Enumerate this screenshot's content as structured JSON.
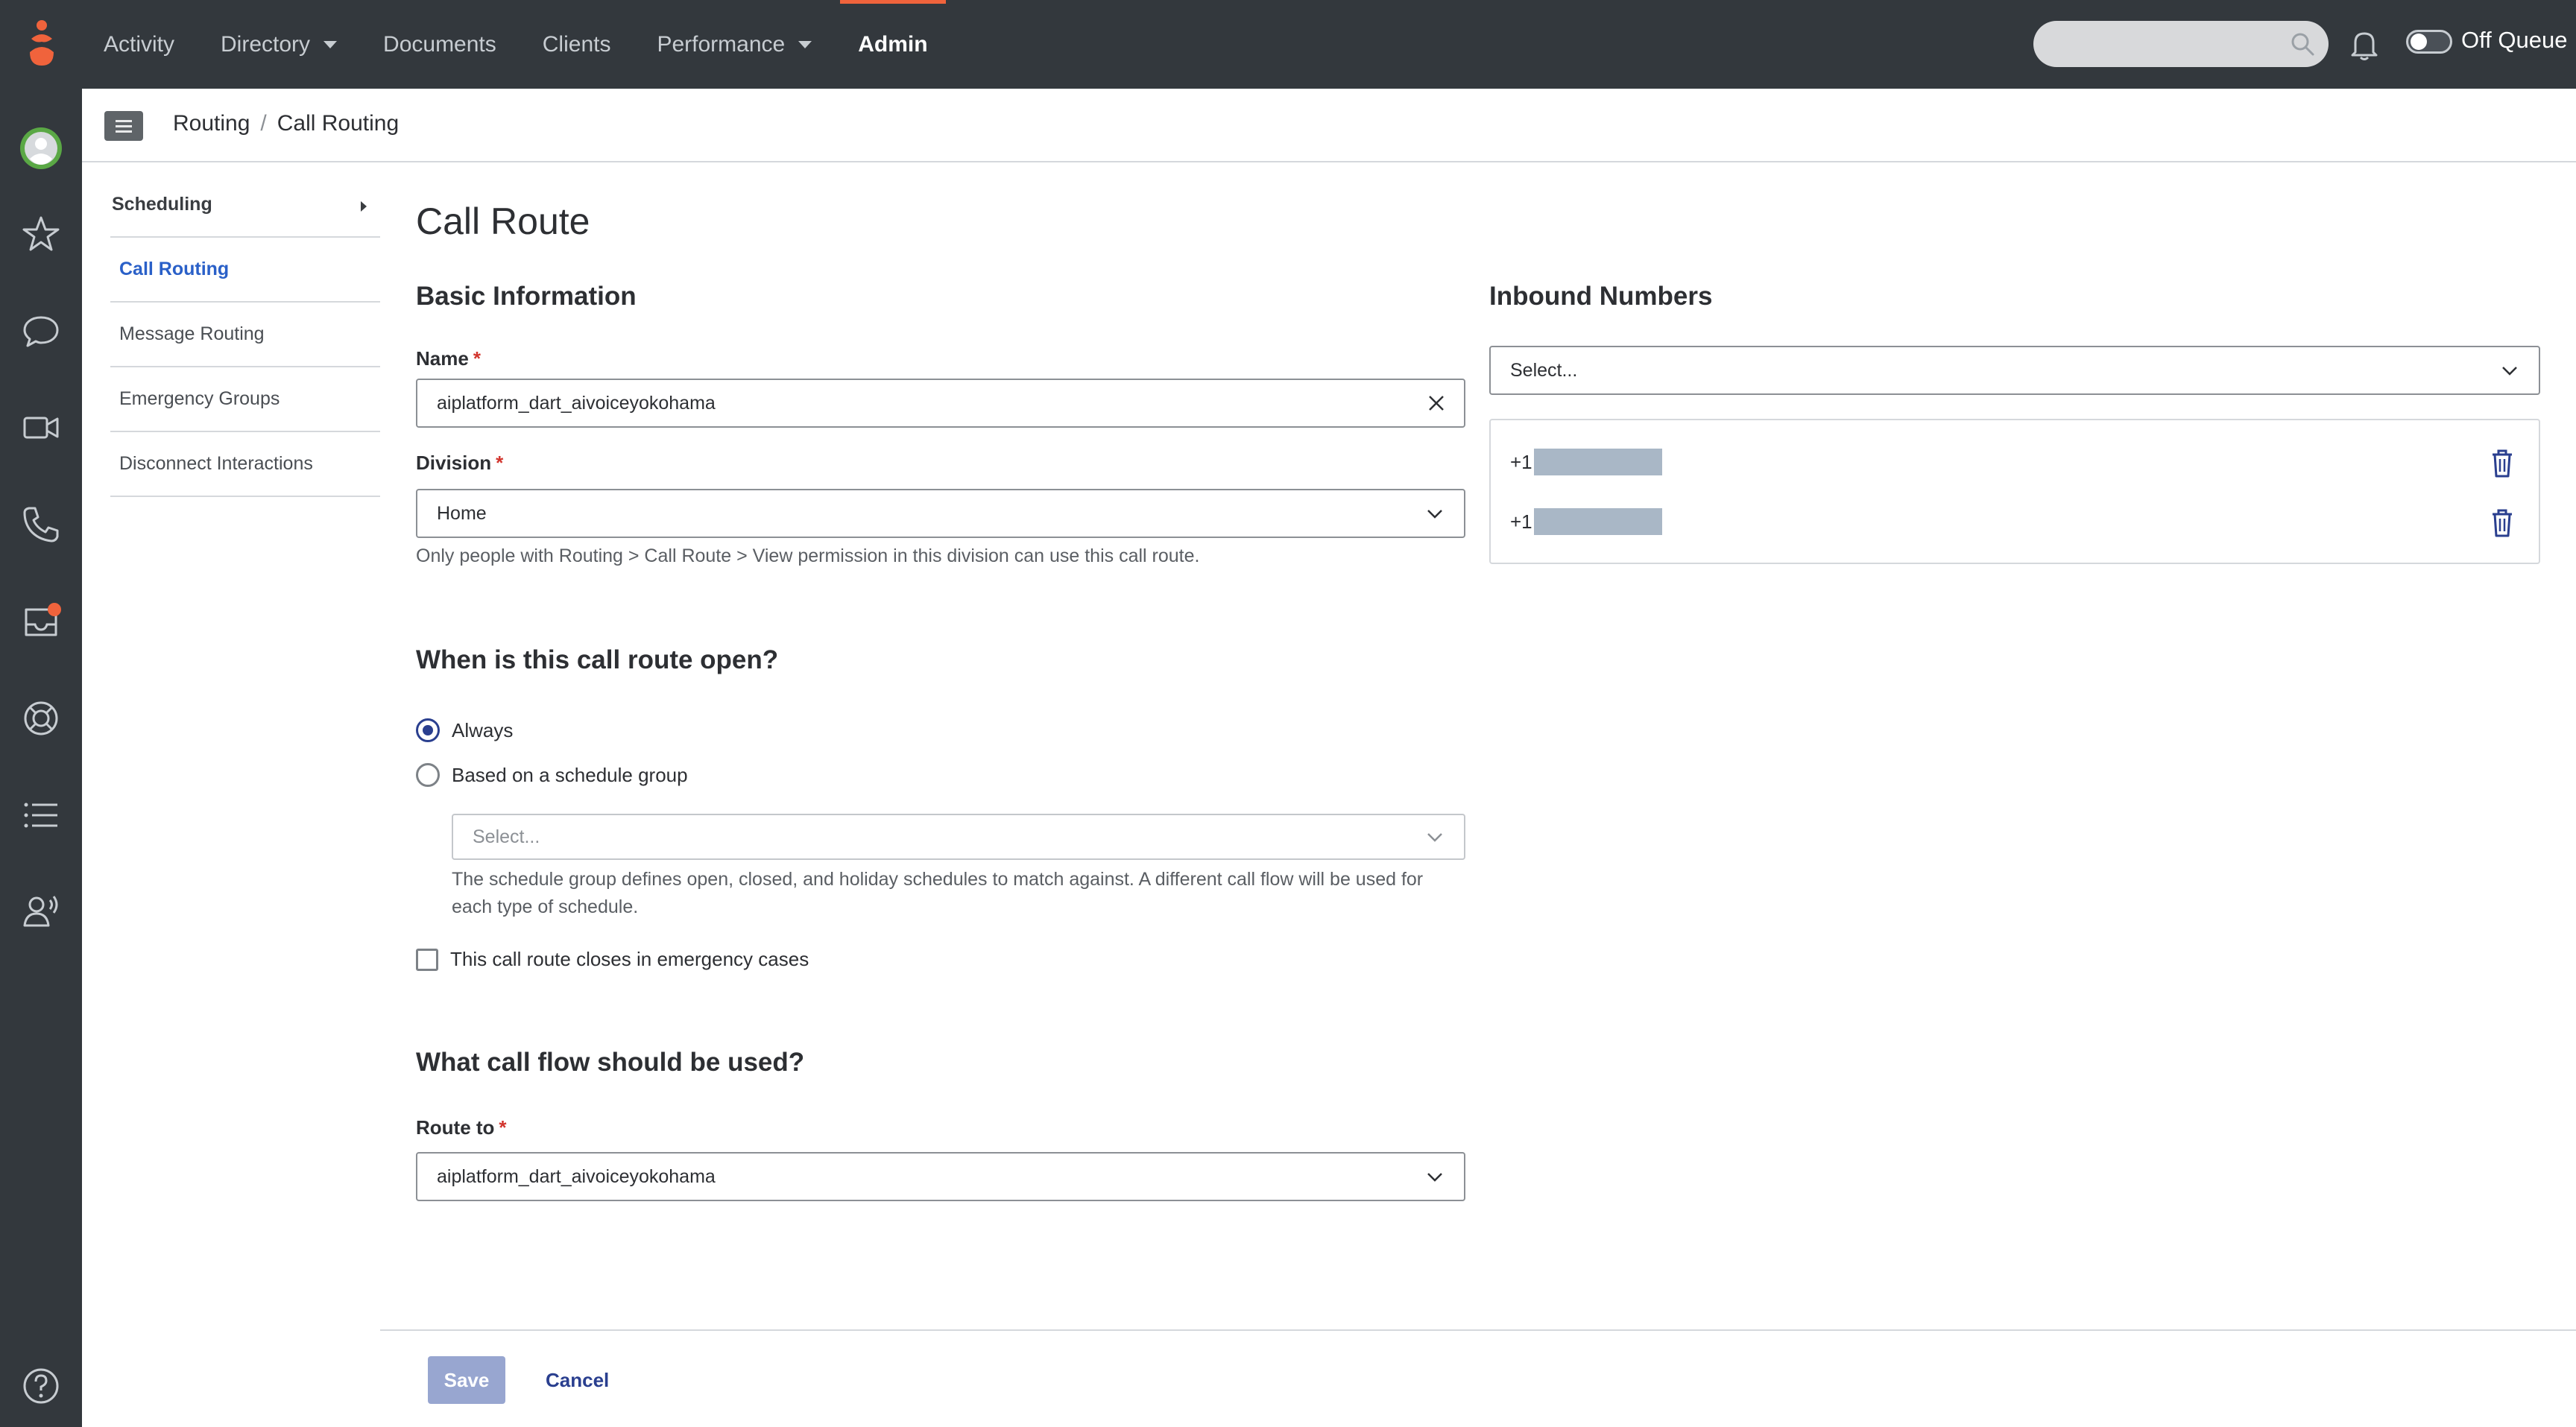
{
  "topnav": {
    "items": [
      {
        "label": "Activity",
        "has_caret": false,
        "active": false
      },
      {
        "label": "Directory",
        "has_caret": true,
        "active": false
      },
      {
        "label": "Documents",
        "has_caret": false,
        "active": false
      },
      {
        "label": "Clients",
        "has_caret": false,
        "active": false
      },
      {
        "label": "Performance",
        "has_caret": true,
        "active": false
      },
      {
        "label": "Admin",
        "has_caret": false,
        "active": true
      }
    ],
    "search_placeholder": "",
    "queue_status": "Off Queue"
  },
  "rail": {
    "icons": [
      "avatar-icon",
      "star-icon",
      "chat-icon",
      "video-icon",
      "phone-icon",
      "inbox-icon",
      "support-icon",
      "list-icon",
      "voice-user-icon",
      "help-icon"
    ]
  },
  "breadcrumb": {
    "root": "Routing",
    "separator": "/",
    "current": "Call Routing"
  },
  "sidemenu": {
    "header": "Scheduling",
    "items": [
      "Call Routing",
      "Message Routing",
      "Emergency Groups",
      "Disconnect Interactions"
    ]
  },
  "form": {
    "title": "Call Route",
    "basic_info_heading": "Basic Information",
    "name_label": "Name",
    "name_value": "aiplatform_dart_aivoiceyokohama",
    "division_label": "Division",
    "division_value": "Home",
    "division_help": "Only people with Routing > Call Route > View permission in this division can use this call route.",
    "open_heading": "When is this call route open?",
    "option_always": "Always",
    "option_schedule": "Based on a schedule group",
    "schedule_placeholder": "Select...",
    "schedule_help_line1": "The schedule group defines open, closed, and holiday schedules to match against. A different call flow will be used for",
    "schedule_help_line2": "each type of schedule.",
    "emergency_label": "This call route closes in emergency cases",
    "flow_heading": "What call flow should be used?",
    "route_label": "Route to",
    "route_value": "aiplatform_dart_aivoiceyokohama",
    "required_mark": "*"
  },
  "inbound": {
    "heading": "Inbound Numbers",
    "select_placeholder": "Select...",
    "numbers": [
      {
        "prefix": "+1"
      },
      {
        "prefix": "+1"
      }
    ]
  },
  "footer": {
    "save_label": "Save",
    "cancel_label": "Cancel"
  },
  "colors": {
    "topbar": "#33383d",
    "accent_orange": "#f0633c",
    "link_blue": "#2a60c8",
    "primary_navy": "#2a3f8f",
    "save_disabled": "#98a6d0"
  }
}
